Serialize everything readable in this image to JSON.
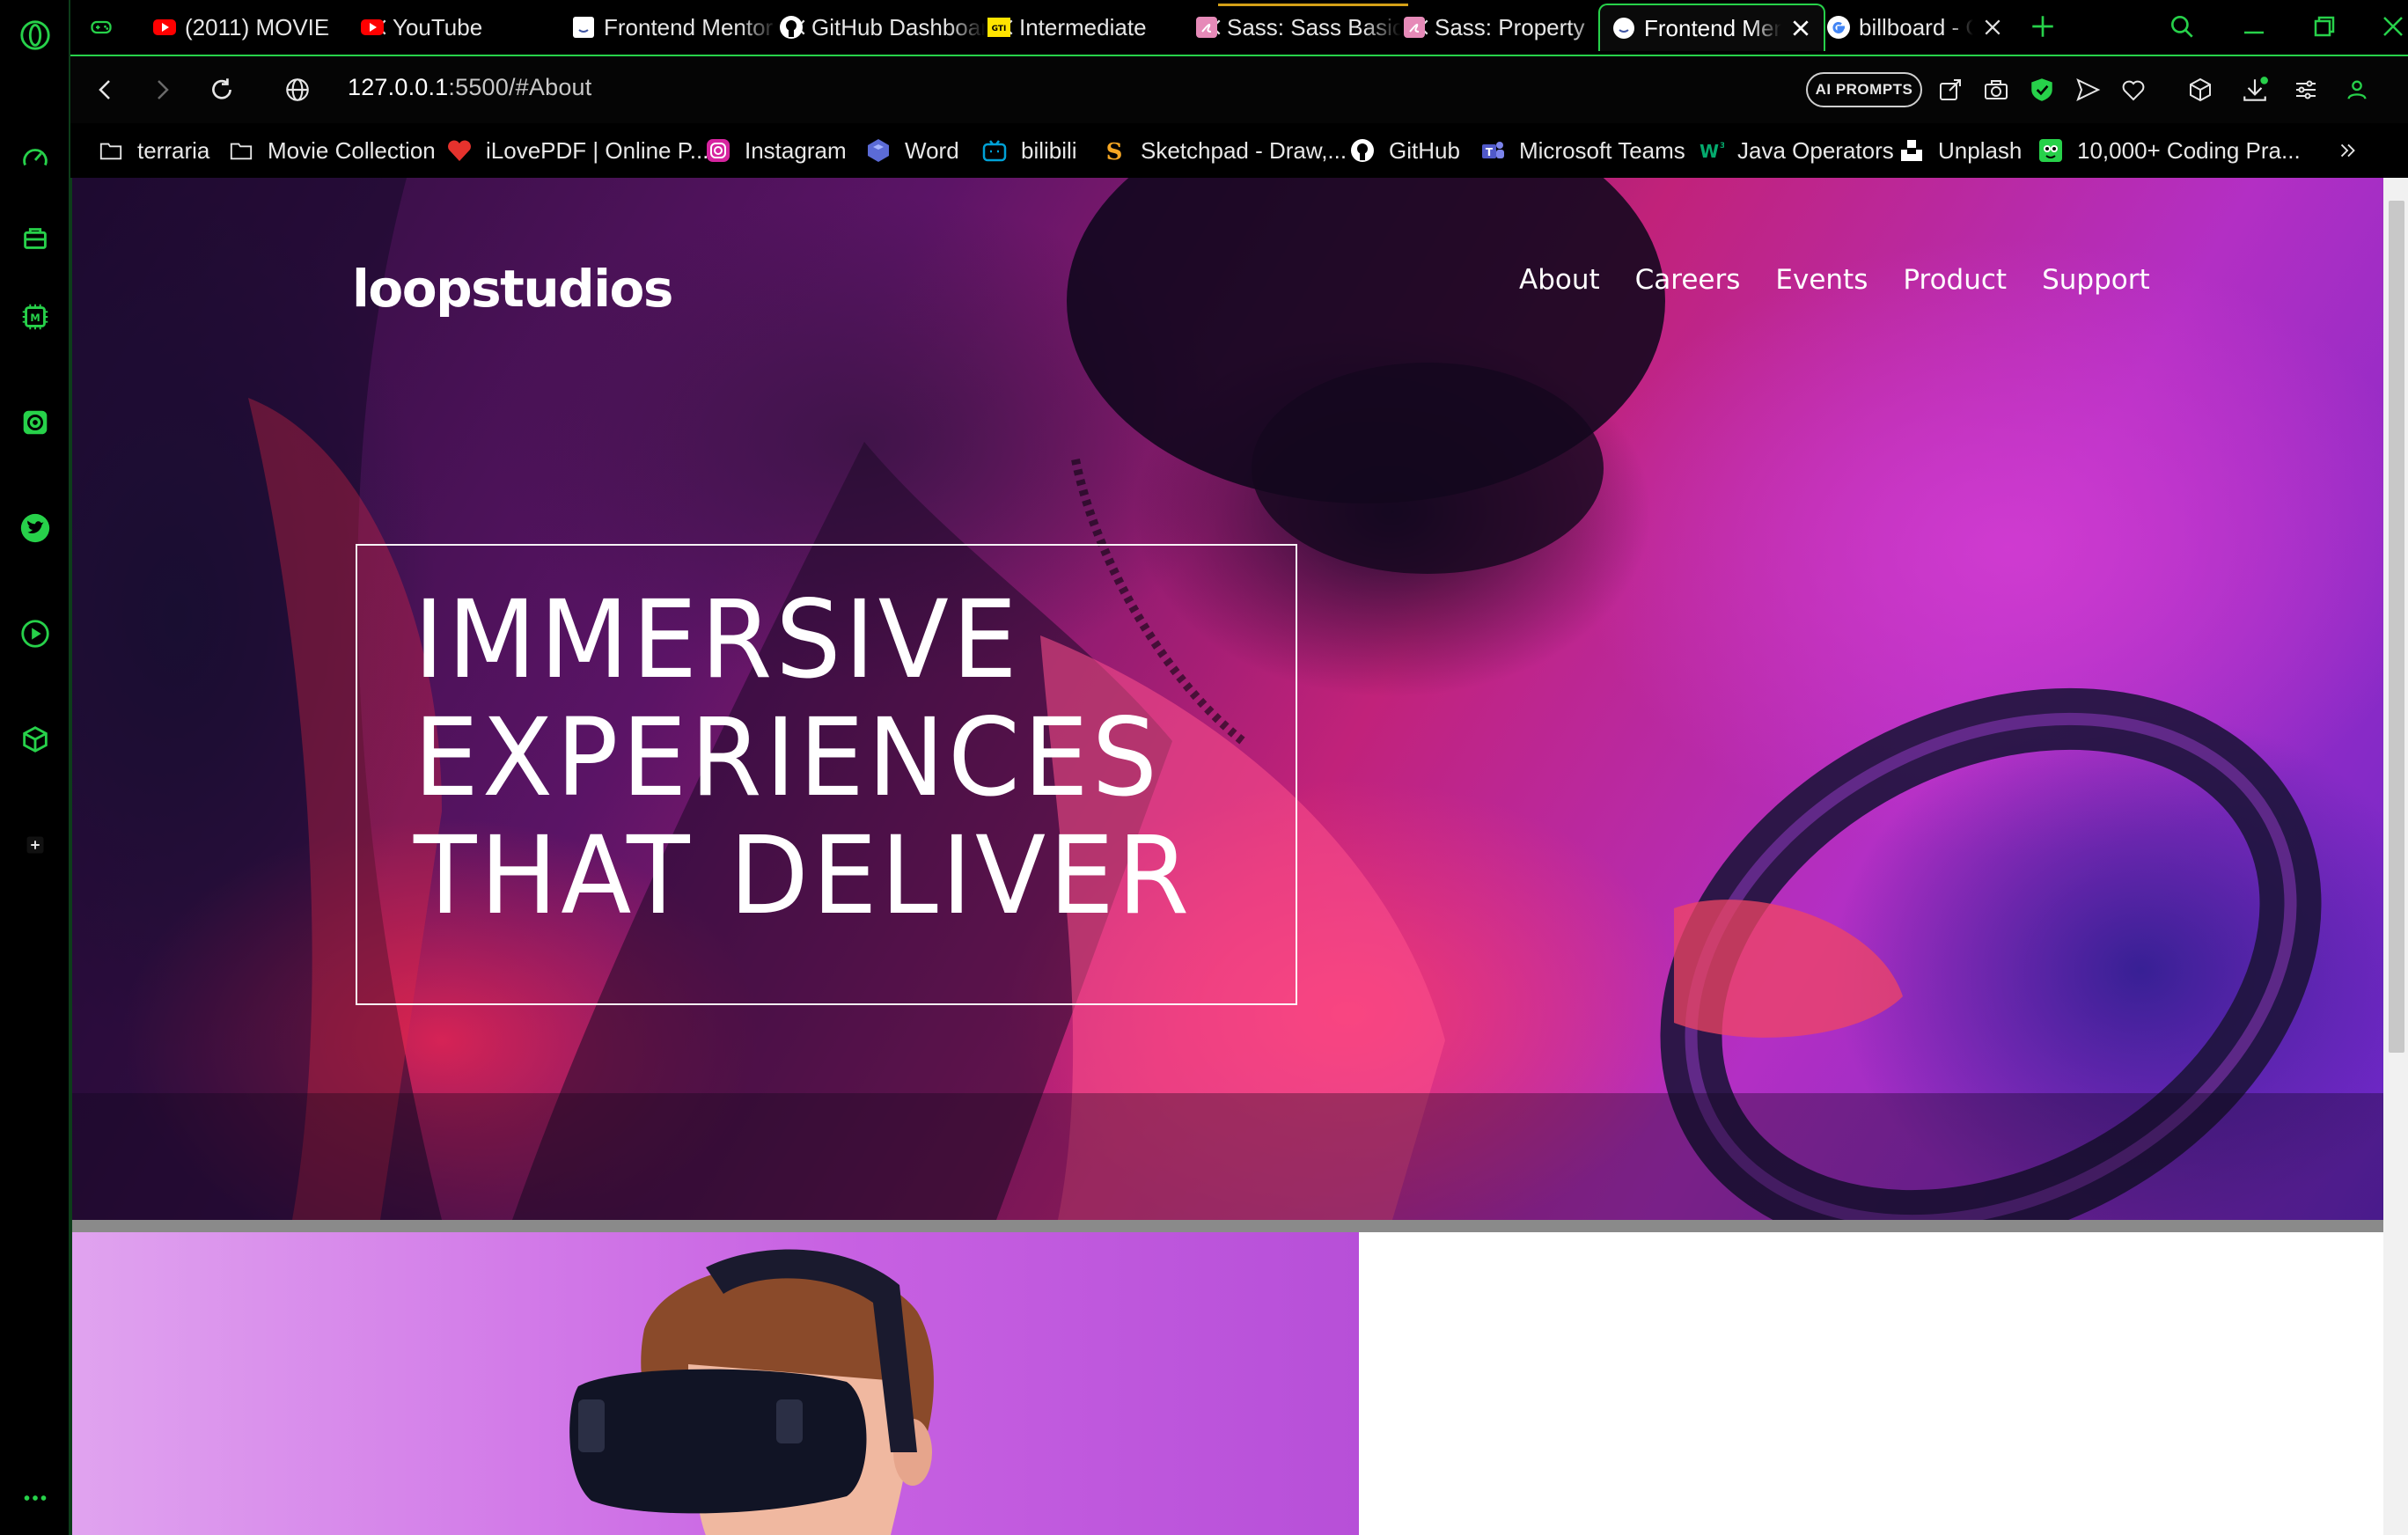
{
  "browser": {
    "accent_color": "#27d14a",
    "tabs": [
      {
        "title": "(2011) MOVIE",
        "favicon": "youtube-icon",
        "active": false
      },
      {
        "title": "YouTube",
        "favicon": "youtube-icon",
        "active": false
      },
      {
        "title": "Frontend Mentor",
        "favicon": "frontend-mentor-icon",
        "active": false
      },
      {
        "title": "GitHub Dashboard",
        "favicon": "github-icon",
        "active": false
      },
      {
        "title": "Intermediate",
        "favicon": "w3schools-icon",
        "active": false
      },
      {
        "title": "Sass: Sass Basics",
        "favicon": "sass-icon",
        "active": false
      },
      {
        "title": "Sass: Property",
        "favicon": "sass-icon",
        "active": false
      },
      {
        "title": "Frontend Mentor",
        "favicon": "frontend-mentor-icon",
        "active": true
      },
      {
        "title": "billboard - Google",
        "favicon": "google-icon",
        "active": false
      }
    ],
    "address": {
      "url_host": "127.0.0.1",
      "url_rest": ":5500/#About"
    },
    "ai_prompts_label": "AI PROMPTS",
    "bookmarks": [
      {
        "label": "terraria",
        "icon": "folder-icon"
      },
      {
        "label": "Movie Collection",
        "icon": "folder-icon"
      },
      {
        "label": "iLovePDF | Online P...",
        "icon": "ilovepdf-icon"
      },
      {
        "label": "Instagram",
        "icon": "instagram-icon"
      },
      {
        "label": "Word",
        "icon": "word-icon"
      },
      {
        "label": "bilibili",
        "icon": "bilibili-icon"
      },
      {
        "label": "Sketchpad - Draw,...",
        "icon": "sketchpad-icon"
      },
      {
        "label": "GitHub",
        "icon": "github-icon"
      },
      {
        "label": "Microsoft Teams",
        "icon": "teams-icon"
      },
      {
        "label": "Java Operators",
        "icon": "w3schools-icon"
      },
      {
        "label": "Unplash",
        "icon": "unsplash-icon"
      },
      {
        "label": "10,000+ Coding Pra...",
        "icon": "edabit-icon"
      }
    ]
  },
  "page": {
    "logo": "loopstudios",
    "nav": [
      "About",
      "Careers",
      "Events",
      "Product",
      "Support"
    ],
    "headline": [
      "IMMERSIVE",
      "EXPERIENCES",
      "THAT DELIVER"
    ]
  }
}
